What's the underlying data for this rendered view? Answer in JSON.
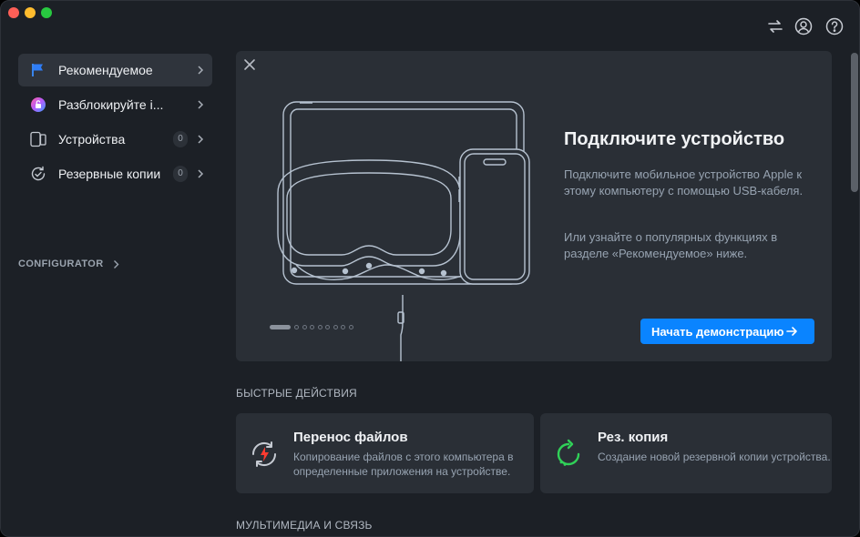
{
  "toolbar": {
    "icons": [
      "transfer-arrows-icon",
      "account-icon",
      "help-icon"
    ]
  },
  "sidebar": {
    "items": [
      {
        "label": "Рекомендуемое",
        "icon": "flag-icon",
        "badge": null,
        "active": true
      },
      {
        "label": "Разблокируйте i...",
        "icon": "unlock-icon",
        "badge": null,
        "active": false
      },
      {
        "label": "Устройства",
        "icon": "devices-icon",
        "badge": "0",
        "active": false
      },
      {
        "label": "Резервные копии",
        "icon": "backup-icon",
        "badge": "0",
        "active": false
      }
    ],
    "section": "CONFIGURATOR"
  },
  "hero": {
    "title": "Подключите устройство",
    "paragraph1": "Подключите мобильное устройство Apple к этому компьютеру с помощью USB-кабеля.",
    "paragraph2": "Или узнайте о популярных функциях в разделе «Рекомендуемое» ниже.",
    "button": "Начать демонстрацию",
    "pager": {
      "current": 1,
      "total": 9
    }
  },
  "quick_actions": {
    "heading": "БЫСТРЫЕ ДЕЙСТВИЯ",
    "cards": [
      {
        "title": "Перенос файлов",
        "desc": "Копирование файлов с этого компьютера в определенные приложения на устройстве.",
        "icon": "file-transfer-icon",
        "accent": "#ff3b30"
      },
      {
        "title": "Рез. копия",
        "desc": "Создание новой резервной копии устройства.",
        "icon": "backup-refresh-icon",
        "accent": "#30d158"
      }
    ]
  },
  "media": {
    "heading": "МУЛЬТИМЕДИА И СВЯЗЬ"
  },
  "colors": {
    "accent": "#0a84ff",
    "window_bg": "#1c2026",
    "card_bg": "#2a2f36"
  }
}
